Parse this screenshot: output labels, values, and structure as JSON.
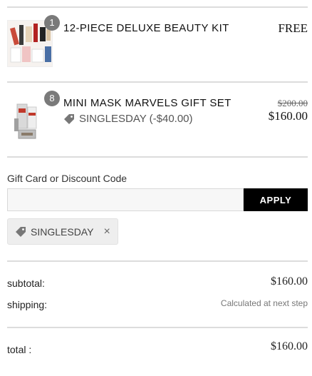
{
  "items": [
    {
      "quantity": "1",
      "name": "12-PIECE DELUXE BEAUTY KIT",
      "price": "FREE",
      "image_icon": "beauty-kit-thumbnail"
    },
    {
      "quantity": "8",
      "name": "MINI MASK MARVELS GIFT SET",
      "original_price": "$200.00",
      "price": "$160.00",
      "discount": "SINGLESDAY (-$40.00)",
      "image_icon": "mask-set-thumbnail"
    }
  ],
  "discount_section": {
    "label": "Gift Card or Discount Code",
    "input_value": "",
    "apply_label": "APPLY",
    "applied_code": "SINGLESDAY"
  },
  "summary": {
    "subtotal_label": "subtotal:",
    "subtotal_value": "$160.00",
    "shipping_label": "shipping:",
    "shipping_value": "Calculated at next step",
    "total_label": "total :",
    "total_value": "$160.00"
  },
  "colors": {
    "accent": "#000000",
    "badge": "#7a7a7a",
    "chip_bg": "#eeeeee"
  }
}
